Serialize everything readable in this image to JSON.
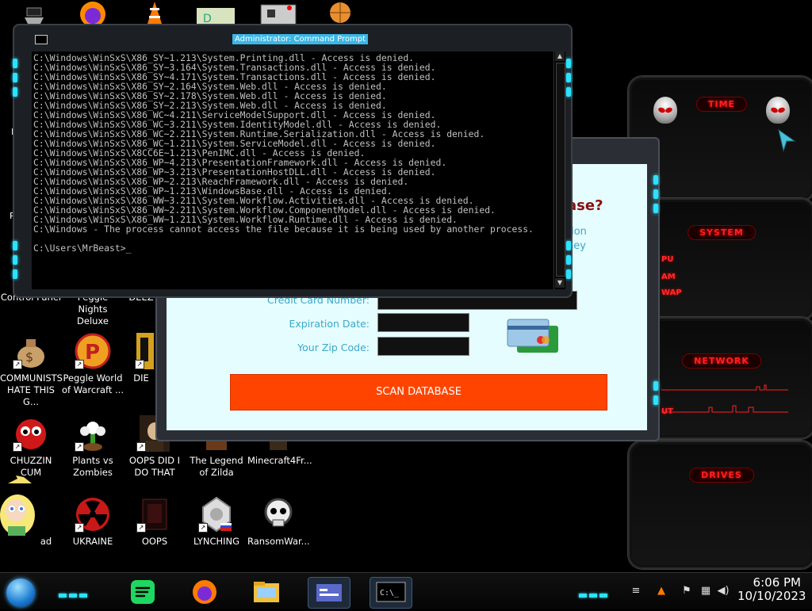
{
  "desktop": {
    "icons": [
      {
        "label": "Control Panel",
        "icon": "control-panel-icon"
      },
      {
        "label": "Peggle Nights Deluxe",
        "icon": "peggle-nights-icon"
      },
      {
        "label": "DEEZ",
        "icon": "deez-icon"
      },
      {
        "label": "COMMUNISTS HATE THIS G...",
        "icon": "money-bag-icon"
      },
      {
        "label": "Peggle World of Warcraft ...",
        "icon": "peggle-wow-icon"
      },
      {
        "label": "DIE",
        "icon": "die-icon"
      },
      {
        "label": "CHUZZIN CUM",
        "icon": "chuzzle-icon"
      },
      {
        "label": "Plants vs Zombies",
        "icon": "pvz-icon"
      },
      {
        "label": "OOPS DID I DO THAT",
        "icon": "portrait-icon"
      },
      {
        "label": "The Legend of Zilda",
        "icon": "zelda-icon"
      },
      {
        "label": "Minecraft4Fr...",
        "icon": "minecraft-icon"
      },
      {
        "label": "ad",
        "icon": "star-character-icon"
      },
      {
        "label": "UKRAINE",
        "icon": "radiation-icon"
      },
      {
        "label": "OOPS",
        "icon": "dark-app-icon"
      },
      {
        "label": "LYNCHING",
        "icon": "ornament-icon"
      },
      {
        "label": "RansomWar...",
        "icon": "skull-icon"
      }
    ]
  },
  "cmd": {
    "title": "Administrator: Command Prompt",
    "lines": [
      "C:\\Windows\\WinSxS\\X86_SY~1.213\\System.Printing.dll - Access is denied.",
      "C:\\Windows\\WinSxS\\X86_SY~3.164\\System.Transactions.dll - Access is denied.",
      "C:\\Windows\\WinSxS\\X86_SY~4.171\\System.Transactions.dll - Access is denied.",
      "C:\\Windows\\WinSxS\\X86_SY~2.164\\System.Web.dll - Access is denied.",
      "C:\\Windows\\WinSxS\\X86_SY~2.178\\System.Web.dll - Access is denied.",
      "C:\\Windows\\WinSxS\\X86_SY~2.213\\System.Web.dll - Access is denied.",
      "C:\\Windows\\WinSxS\\X86_WC~4.211\\ServiceModelSupport.dll - Access is denied.",
      "C:\\Windows\\WinSxS\\X86_WC~3.211\\System.IdentityModel.dll - Access is denied.",
      "C:\\Windows\\WinSxS\\X86_WC~2.211\\System.Runtime.Serialization.dll - Access is denied.",
      "C:\\Windows\\WinSxS\\X86_WC~1.211\\System.ServiceModel.dll - Access is denied.",
      "C:\\Windows\\WinSxS\\X8CC6E~1.213\\PenIMC.dll - Access is denied.",
      "C:\\Windows\\WinSxS\\X86_WP~4.213\\PresentationFramework.dll - Access is denied.",
      "C:\\Windows\\WinSxS\\X86_WP~3.213\\PresentationHostDLL.dll - Access is denied.",
      "C:\\Windows\\WinSxS\\X86_WP~2.213\\ReachFramework.dll - Access is denied.",
      "C:\\Windows\\WinSxS\\X86_WP~1.213\\WindowsBase.dll - Access is denied.",
      "C:\\Windows\\WinSxS\\X86_WW~3.211\\System.Workflow.Activities.dll - Access is denied.",
      "C:\\Windows\\WinSxS\\X86_WW~2.211\\System.Workflow.ComponentModel.dll - Access is denied.",
      "C:\\Windows\\WinSxS\\X86_WW~1.211\\System.Workflow.Runtime.dll - Access is denied.",
      "C:\\Windows - The process cannot access the file because it is being used by another process.",
      "",
      "C:\\Users\\MrBeast>_"
    ]
  },
  "dialog": {
    "headline": "ase?",
    "side_text_1": "tion",
    "side_text_2": "ney",
    "credit_card_label": "Credit Card Number:",
    "expiration_label": "Expiration Date:",
    "zip_label": "Your Zip Code:",
    "scan_button": "SCAN DATABASE"
  },
  "widgets": {
    "time_title": "TIME",
    "system_title": "SYSTEM",
    "system_labels": [
      "PU",
      "AM",
      "WAP"
    ],
    "network_title": "NETWORK",
    "network_label": "UT",
    "drives_title": "DRIVES"
  },
  "taskbar": {
    "time": "6:06 PM",
    "date": "10/10/2023",
    "apps": [
      "spotify-icon",
      "firefox-icon",
      "file-explorer-icon",
      "control-panel-icon",
      "cmd-icon"
    ]
  },
  "colors": {
    "accent_cyan": "#2ce2ff",
    "widget_red": "#ff2020",
    "scan_button": "#ff4400"
  }
}
